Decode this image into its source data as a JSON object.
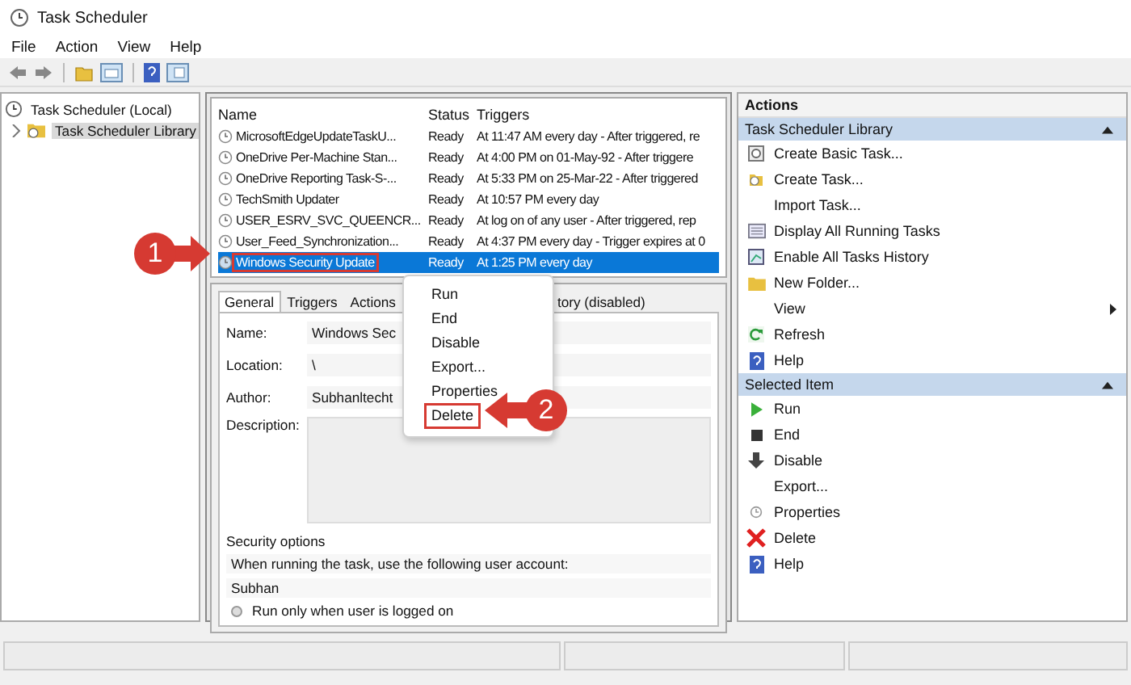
{
  "window": {
    "title": "Task Scheduler"
  },
  "menu": [
    "File",
    "Action",
    "View",
    "Help"
  ],
  "tree": [
    {
      "label": "Task Scheduler (Local)",
      "selected": false,
      "children": [
        {
          "label": "Task Scheduler Library",
          "expanded": false,
          "selected": true
        }
      ]
    }
  ],
  "task_list": {
    "columns": [
      "Name",
      "Status",
      "Triggers"
    ],
    "rows": [
      {
        "name": "MicrosoftEdgeUpdateTaskU...",
        "status": "Ready",
        "triggers": "At 11:47 AM every day - After triggered, re",
        "selected": false,
        "marked": false
      },
      {
        "name": "OneDrive Per-Machine Stan...",
        "status": "Ready",
        "triggers": "At 4:00 PM on 01-May-92 - After triggere",
        "selected": false,
        "marked": false
      },
      {
        "name": "OneDrive Reporting Task-S-...",
        "status": "Ready",
        "triggers": "At 5:33 PM on 25-Mar-22 - After triggered",
        "selected": false,
        "marked": false
      },
      {
        "name": "TechSmith Updater",
        "status": "Ready",
        "triggers": "At 10:57 PM every day",
        "selected": false,
        "marked": false
      },
      {
        "name": "USER_ESRV_SVC_QUEENCR...",
        "status": "Ready",
        "triggers": "At log on of any user - After triggered, rep",
        "selected": false,
        "marked": false
      },
      {
        "name": "User_Feed_Synchronization...",
        "status": "Ready",
        "triggers": "At 4:37 PM every day - Trigger expires at 0",
        "selected": false,
        "marked": false
      },
      {
        "name": "Windows Security Update",
        "status": "Ready",
        "triggers": "At 1:25 PM every day",
        "selected": true,
        "marked": true
      }
    ]
  },
  "context_menu": {
    "items": [
      {
        "label": "Run",
        "marked": false
      },
      {
        "label": "End",
        "marked": false
      },
      {
        "label": "Disable",
        "marked": false
      },
      {
        "label": "Export...",
        "marked": false
      },
      {
        "label": "Properties",
        "marked": false
      },
      {
        "label": "Delete",
        "marked": true
      }
    ]
  },
  "annotations": [
    {
      "number": "1"
    },
    {
      "number": "2"
    }
  ],
  "details": {
    "tabs": [
      {
        "label": "General",
        "selected": true
      },
      {
        "label": "Triggers",
        "selected": false
      },
      {
        "label": "Actions",
        "selected": false
      },
      {
        "label": "tory (disabled)",
        "selected": false
      }
    ],
    "fields": [
      {
        "label": "Name:",
        "value": "Windows Sec",
        "kind": "line"
      },
      {
        "label": "Location:",
        "value": "\\",
        "kind": "line"
      },
      {
        "label": "Author:",
        "value": "Subhanltecht",
        "kind": "line"
      },
      {
        "label": "Description:",
        "kind": "area"
      }
    ],
    "security": {
      "title": "Security options",
      "prompt": "When running the task, use the following user account:",
      "account": "Subhan",
      "option": {
        "label": "Run only when user is logged on",
        "selected": false
      }
    }
  },
  "actions": {
    "title": "Actions",
    "sections": [
      {
        "title": "Task Scheduler Library",
        "expanded": true,
        "items": [
          {
            "label": "Create Basic Task...",
            "submenu": false
          },
          {
            "label": "Create Task...",
            "submenu": false
          },
          {
            "label": "Import Task...",
            "submenu": false
          },
          {
            "label": "Display All Running Tasks",
            "submenu": false
          },
          {
            "label": "Enable All Tasks History",
            "submenu": false
          },
          {
            "label": "New Folder...",
            "submenu": false
          },
          {
            "label": "View",
            "submenu": true
          },
          {
            "label": "Refresh",
            "submenu": false
          },
          {
            "label": "Help",
            "submenu": false
          }
        ]
      },
      {
        "title": "Selected Item",
        "expanded": true,
        "items": [
          {
            "label": "Run",
            "submenu": false
          },
          {
            "label": "End",
            "submenu": false
          },
          {
            "label": "Disable",
            "submenu": false
          },
          {
            "label": "Export...",
            "submenu": false
          },
          {
            "label": "Properties",
            "submenu": false
          },
          {
            "label": "Delete",
            "submenu": false
          },
          {
            "label": "Help",
            "submenu": false
          }
        ]
      }
    ]
  }
}
